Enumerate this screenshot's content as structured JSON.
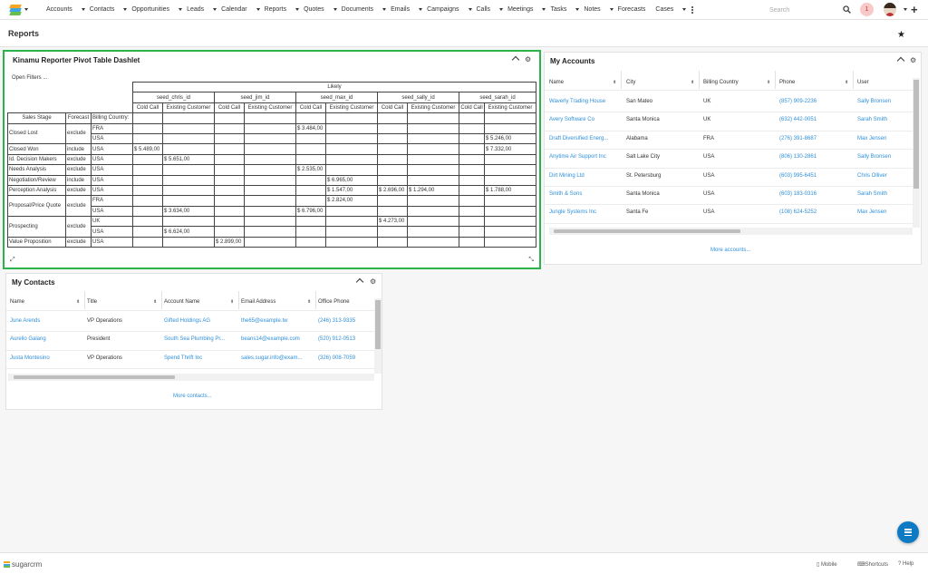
{
  "nav": {
    "items": [
      "Accounts",
      "Contacts",
      "Opportunities",
      "Leads",
      "Calendar",
      "Reports",
      "Quotes",
      "Documents",
      "Emails",
      "Campaigns",
      "Calls",
      "Meetings",
      "Tasks",
      "Notes",
      "Forecasts",
      "Cases"
    ],
    "search_placeholder": "Search",
    "notification_count": "1"
  },
  "page": {
    "title": "Reports"
  },
  "pivot": {
    "title": "Kinamu Reporter Pivot Table Dashlet",
    "open_filters": "Open Filters ...",
    "top_header": "Likely",
    "users": [
      "seed_chris_id",
      "seed_jim_id",
      "seed_max_id",
      "seed_sally_id",
      "seed_sarah_id"
    ],
    "call_types": [
      "Cold Call",
      "Existing Customer"
    ],
    "row_headers": [
      "Sales Stage",
      "Forecast",
      "Billing Country:"
    ],
    "rows": [
      {
        "stage": "Closed Lost",
        "forecast": "exclude",
        "country": "FRA",
        "vals": [
          "",
          "",
          "",
          "",
          "$ 3.484,00",
          "",
          "",
          "",
          "",
          ""
        ]
      },
      {
        "stage": "",
        "forecast": "",
        "country": "USA",
        "vals": [
          "",
          "",
          "",
          "",
          "",
          "",
          "",
          "",
          "",
          "$ 5.246,00"
        ]
      },
      {
        "stage": "Closed Won",
        "forecast": "include",
        "country": "USA",
        "vals": [
          "$ 5.489,00",
          "",
          "",
          "",
          "",
          "",
          "",
          "",
          "",
          "$ 7.332,00"
        ]
      },
      {
        "stage": "Id. Decision Makers",
        "forecast": "exclude",
        "country": "USA",
        "vals": [
          "",
          "$ 5.651,00",
          "",
          "",
          "",
          "",
          "",
          "",
          "",
          ""
        ]
      },
      {
        "stage": "Needs Analysis",
        "forecast": "exclude",
        "country": "USA",
        "vals": [
          "",
          "",
          "",
          "",
          "$ 2.535,00",
          "",
          "",
          "",
          "",
          ""
        ]
      },
      {
        "stage": "Negotiation/Review",
        "forecast": "include",
        "country": "USA",
        "vals": [
          "",
          "",
          "",
          "",
          "",
          "$ 6.965,00",
          "",
          "",
          "",
          ""
        ]
      },
      {
        "stage": "Perception Analysis",
        "forecast": "exclude",
        "country": "USA",
        "vals": [
          "",
          "",
          "",
          "",
          "",
          "$ 1.547,00",
          "$ 2.696,00",
          "$ 1.294,00",
          "",
          "$ 1.788,00"
        ]
      },
      {
        "stage": "Proposal/Price Quote",
        "forecast": "exclude",
        "country": "FRA",
        "vals": [
          "",
          "",
          "",
          "",
          "",
          "$ 2.824,00",
          "",
          "",
          "",
          ""
        ]
      },
      {
        "stage": "",
        "forecast": "",
        "country": "USA",
        "vals": [
          "",
          "$ 3.634,00",
          "",
          "",
          "$ 6.796,00",
          "",
          "",
          "",
          "",
          ""
        ]
      },
      {
        "stage": "Prospecting",
        "forecast": "exclude",
        "country": "UK",
        "vals": [
          "",
          "",
          "",
          "",
          "",
          "",
          "$ 4.273,00",
          "",
          "",
          ""
        ]
      },
      {
        "stage": "",
        "forecast": "",
        "country": "USA",
        "vals": [
          "",
          "$ 6.624,00",
          "",
          "",
          "",
          "",
          "",
          "",
          "",
          ""
        ]
      },
      {
        "stage": "Value Proposition",
        "forecast": "exclude",
        "country": "USA",
        "vals": [
          "",
          "",
          "$ 2.899,00",
          "",
          "",
          "",
          "",
          "",
          "",
          ""
        ]
      }
    ]
  },
  "accounts": {
    "title": "My Accounts",
    "columns": [
      "Name",
      "City",
      "Billing Country",
      "Phone",
      "User"
    ],
    "rows": [
      [
        "Waverly Trading House",
        "San Mateo",
        "UK",
        "(857) 909-2236",
        "Sally Bronsen"
      ],
      [
        "Avery Software Co",
        "Santa Monica",
        "UK",
        "(632) 442-0051",
        "Sarah Smith"
      ],
      [
        "Draft Diversified Energ...",
        "Alabama",
        "FRA",
        "(276) 391-8687",
        "Max Jensen"
      ],
      [
        "Anytime Air Support Inc",
        "Salt Lake City",
        "USA",
        "(806) 130-2861",
        "Sally Bronsen"
      ],
      [
        "Dirt Mining Ltd",
        "St. Petersburg",
        "USA",
        "(603) 995-6451",
        "Chris Olliver"
      ],
      [
        "Smith & Sons",
        "Santa Monica",
        "USA",
        "(603) 183-0316",
        "Sarah Smith"
      ],
      [
        "Jungle Systems Inc",
        "Santa Fe",
        "USA",
        "(108) 624-5252",
        "Max Jensen"
      ]
    ],
    "more": "More accounts..."
  },
  "contacts": {
    "title": "My Contacts",
    "columns": [
      "Name",
      "Title",
      "Account Name",
      "Email Address",
      "Office Phone"
    ],
    "rows": [
      [
        "June Arends",
        "VP Operations",
        "Gifted Holdings AG",
        "the65@example.tw",
        "(246) 313-9335"
      ],
      [
        "Aurelio Galang",
        "President",
        "South Sea Plumbing Pr...",
        "beans14@example.com",
        "(520) 912-0513"
      ],
      [
        "Justa Montesino",
        "VP Operations",
        "Spend Thrift Inc",
        "sales.sugar.info@exam...",
        "(326) 008-7059"
      ]
    ],
    "more": "More contacts..."
  },
  "footer": {
    "brand": "sugarcrm",
    "mobile": "Mobile",
    "shortcuts": "Shortcuts",
    "help": "Help"
  },
  "colors": {
    "accent": "#2f8fd8",
    "highlight_border": "#29b34a",
    "fab": "#0e7ac4"
  }
}
